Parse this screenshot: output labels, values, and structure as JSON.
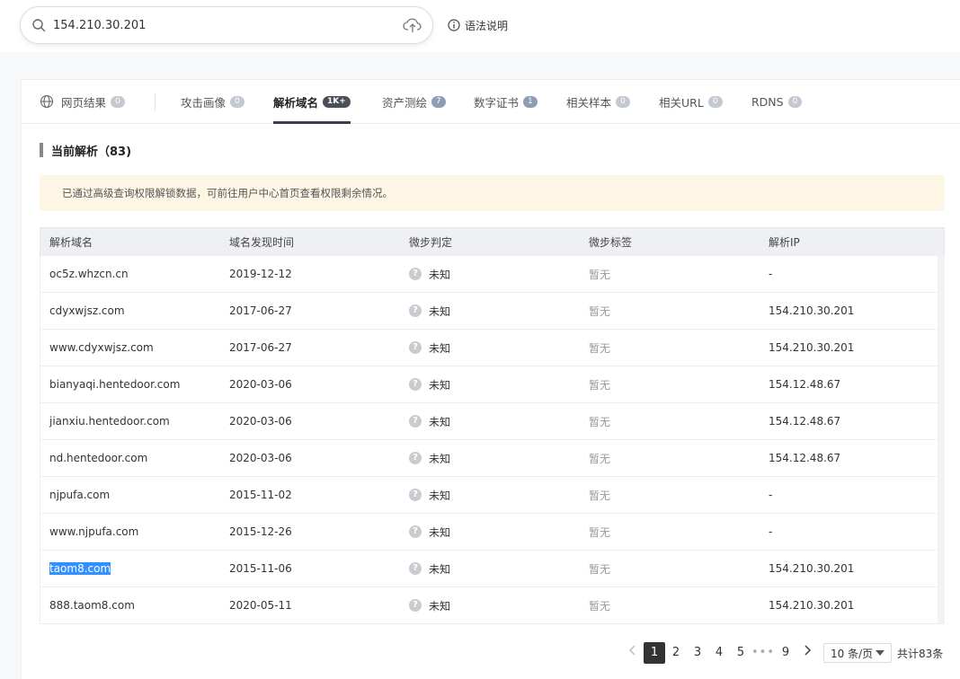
{
  "search": {
    "value": "154.210.30.201"
  },
  "syntax_help": "语法说明",
  "tabs": [
    {
      "label": "网页结果",
      "count": "0"
    },
    {
      "label": "攻击画像",
      "count": "0"
    },
    {
      "label": "解析域名",
      "count": "1K+"
    },
    {
      "label": "资产测绘",
      "count": "7"
    },
    {
      "label": "数字证书",
      "count": "1"
    },
    {
      "label": "相关样本",
      "count": "0"
    },
    {
      "label": "相关URL",
      "count": "0"
    },
    {
      "label": "RDNS",
      "count": "0"
    }
  ],
  "section": {
    "title": "当前解析（83)"
  },
  "notice": "已通过高级查询权限解锁数据，可前往用户中心首页查看权限剩余情况。",
  "table": {
    "headers": [
      "解析域名",
      "域名发现时间",
      "微步判定",
      "微步标签",
      "解析IP"
    ],
    "rows": [
      {
        "domain": "oc5z.whzcn.cn",
        "date": "2019-12-12",
        "verdict": "未知",
        "tag": "暂无",
        "ip": "-"
      },
      {
        "domain": "cdyxwjsz.com",
        "date": "2017-06-27",
        "verdict": "未知",
        "tag": "暂无",
        "ip": "154.210.30.201"
      },
      {
        "domain": "www.cdyxwjsz.com",
        "date": "2017-06-27",
        "verdict": "未知",
        "tag": "暂无",
        "ip": "154.210.30.201"
      },
      {
        "domain": "bianyaqi.hentedoor.com",
        "date": "2020-03-06",
        "verdict": "未知",
        "tag": "暂无",
        "ip": "154.12.48.67"
      },
      {
        "domain": "jianxiu.hentedoor.com",
        "date": "2020-03-06",
        "verdict": "未知",
        "tag": "暂无",
        "ip": "154.12.48.67"
      },
      {
        "domain": "nd.hentedoor.com",
        "date": "2020-03-06",
        "verdict": "未知",
        "tag": "暂无",
        "ip": "154.12.48.67"
      },
      {
        "domain": "njpufa.com",
        "date": "2015-11-02",
        "verdict": "未知",
        "tag": "暂无",
        "ip": "-"
      },
      {
        "domain": "www.njpufa.com",
        "date": "2015-12-26",
        "verdict": "未知",
        "tag": "暂无",
        "ip": "-"
      },
      {
        "domain": "taom8.com",
        "date": "2015-11-06",
        "verdict": "未知",
        "tag": "暂无",
        "ip": "154.210.30.201"
      },
      {
        "domain": "888.taom8.com",
        "date": "2020-05-11",
        "verdict": "未知",
        "tag": "暂无",
        "ip": "154.210.30.201"
      }
    ]
  },
  "pagination": {
    "pages": [
      "1",
      "2",
      "3",
      "4",
      "5"
    ],
    "ellipsis": "•••",
    "last": "9",
    "page_size": "10 条/页",
    "total": "共计83条"
  }
}
